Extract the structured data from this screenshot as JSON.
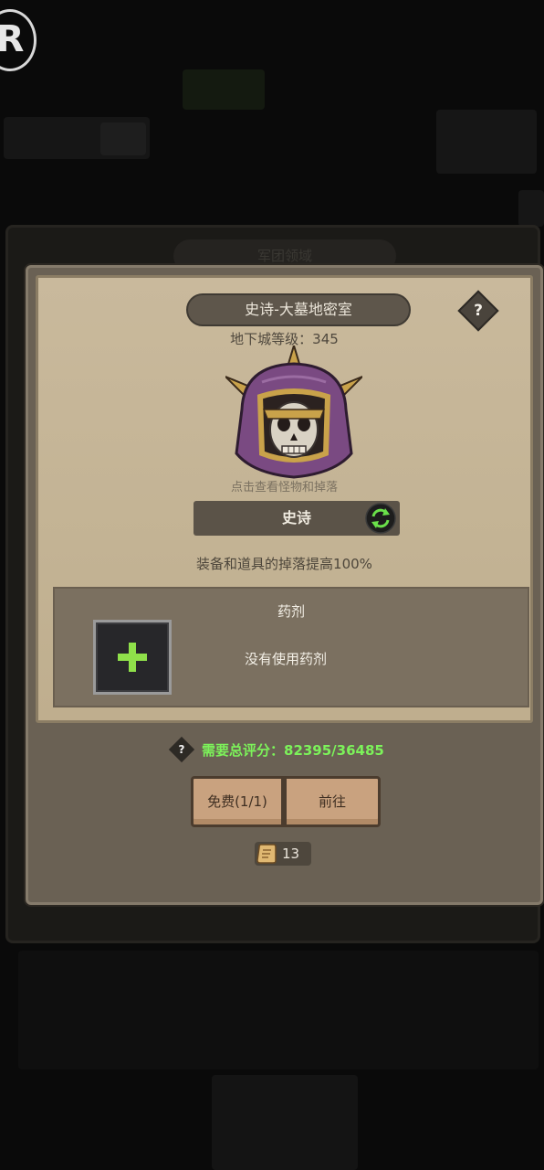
{
  "modal": {
    "title": "史诗-大墓地密室",
    "help_symbol": "?",
    "dungeon_level": "地下城等级：345",
    "tap_hint": "点击查看怪物和掉落",
    "difficulty": "史诗",
    "bonus": "装备和道具的掉落提高100%",
    "potion": {
      "title": "药剂",
      "empty_text": "没有使用药剂"
    },
    "requirement": {
      "icon_symbol": "?",
      "text": "需要总评分：82395/36485"
    },
    "buttons": {
      "free": "免费(1/1)",
      "go": "前往"
    },
    "ticket_count": "13"
  },
  "background": {
    "tab_label": "军团领域",
    "logo_letter": "R"
  },
  "colors": {
    "parchment": "#c9b99c",
    "requirement_green": "#7cf25a",
    "button": "#c9a27f",
    "helmet_purple": "#7a4a82",
    "helmet_gold": "#c9a24a"
  },
  "icons": {
    "help": "question-diamond-icon",
    "refresh": "refresh-cycle-icon",
    "add": "plus-icon",
    "ticket": "scroll-ticket-icon",
    "boss": "skull-helmet-icon"
  }
}
